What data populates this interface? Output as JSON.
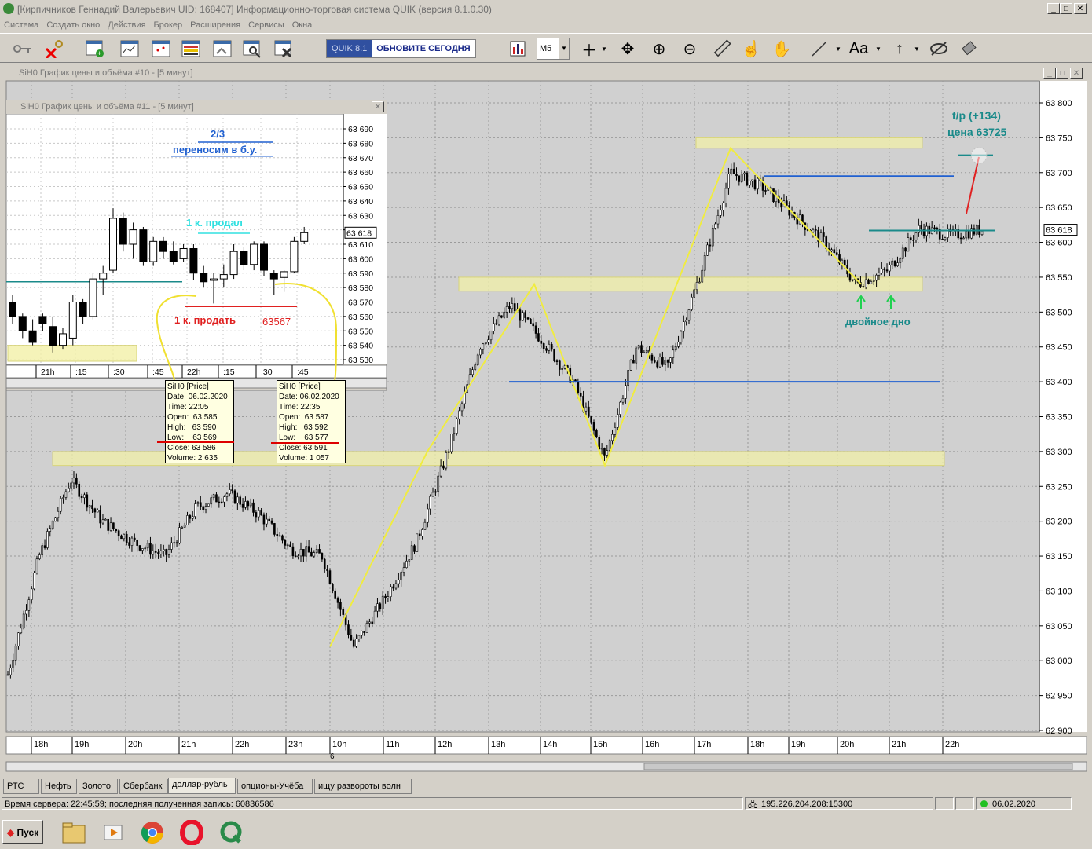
{
  "window": {
    "title": "[Кирпичников Геннадий Валерьевич UID: 168407] Информационно-торговая система QUIK (версия 8.1.0.30)"
  },
  "menu": [
    "Система",
    "Создать окно",
    "Действия",
    "Брокер",
    "Расширения",
    "Сервисы",
    "Окна"
  ],
  "toolbar": {
    "quik_label": "QUIK 8.1",
    "update_label": "ОБНОВИТЕ СЕГОДНЯ",
    "timeframe": "M5",
    "font_label": "Aa"
  },
  "icons": [
    "keys-icon",
    "keys-delete-icon",
    "new-window-icon",
    "chart-window-icon",
    "chart2-icon",
    "table-icon",
    "order-icon",
    "search-icon",
    "delete-icon",
    "indicator-icon",
    "crosshair-icon",
    "move-icon",
    "zoom-in-icon",
    "zoom-out-icon",
    "ruler-icon",
    "hand-pointer-icon",
    "hand-icon",
    "line-icon",
    "arrow-up-icon",
    "eye-off-icon",
    "eraser-icon"
  ],
  "main_chart": {
    "title": "SiH0 График цены и объёма #10 - [5 минут]",
    "y_ticks": [
      "63 800",
      "63 750",
      "63 700",
      "63 650",
      "63 600",
      "63 550",
      "63 500",
      "63 450",
      "63 400",
      "63 350",
      "63 300",
      "63 250",
      "63 200",
      "63 150",
      "63 100",
      "63 050",
      "63 000",
      "62 950",
      "62 900"
    ],
    "x_ticks": [
      "18h",
      "19h",
      "20h",
      "21h",
      "22h",
      "23h",
      "10h",
      "11h",
      "12h",
      "13h",
      "14h",
      "15h",
      "16h",
      "17h",
      "18h",
      "19h",
      "20h",
      "21h",
      "22h"
    ],
    "day_label": "6",
    "last_price": "63 618",
    "annotations": {
      "tp": "t/p (+134)",
      "price": "цена  63725",
      "double_bottom": "двойное дно"
    }
  },
  "inset_chart": {
    "title": "SiH0 График цены и объёма #11 - [5 минут]",
    "y_ticks": [
      "63 690",
      "63 680",
      "63 670",
      "63 660",
      "63 650",
      "63 640",
      "63 630",
      "63 620",
      "63 610",
      "63 600",
      "63 590",
      "63 580",
      "63 570",
      "63 560",
      "63 550",
      "63 540",
      "63 530"
    ],
    "x_ticks": [
      "21h",
      ":15",
      ":30",
      ":45",
      "22h",
      ":15",
      ":30",
      ":45"
    ],
    "last_price": "63 618",
    "annotations": {
      "fraction": "2/3",
      "move_be": "переносим в б.у.",
      "sold": "1 к. продал",
      "sell": "1 к. продать",
      "sell_price": "63567"
    }
  },
  "tooltips": [
    {
      "title": "SiH0 [Price]",
      "date": "Date: 06.02.2020",
      "time": "Time: 22:05",
      "open": "Open:  63 585",
      "high": "High:   63 590",
      "low": "Low:    63 569",
      "close": "Close: 63 586",
      "volume": "Volume: 2 635"
    },
    {
      "title": "SiH0 [Price]",
      "date": "Date: 06.02.2020",
      "time": "Time: 22:35",
      "open": "Open:  63 587",
      "high": "High:   63 592",
      "low": "Low:    63 577",
      "close": "Close: 63 591",
      "volume": "Volume: 1 057"
    }
  ],
  "tabs": [
    "РТС",
    "Нефть",
    "Золото",
    "Сбербанк",
    "доллар-рубль",
    "опционы-Учёба",
    "ищу развороты волн"
  ],
  "active_tab": "доллар-рубль",
  "status": {
    "server_time": "Время сервера: 22:45:59; последняя полученная запись: 60836586",
    "ip": "195.226.204.208:15300",
    "date": "06.02.2020"
  },
  "taskbar": {
    "start_label": "Пуск"
  },
  "chart_data": [
    {
      "type": "candlestick",
      "title": "SiH0 График цены и объёма #10 - [5 минут]",
      "ylim": [
        62900,
        63800
      ],
      "x": [
        "18h",
        "19h",
        "20h",
        "21h",
        "22h",
        "23h",
        "10h",
        "11h",
        "12h",
        "13h",
        "14h",
        "15h",
        "16h",
        "17h",
        "18h",
        "19h",
        "20h",
        "21h",
        "22h"
      ],
      "close_path": [
        62980,
        63150,
        63260,
        63200,
        63170,
        63150,
        63220,
        63240,
        63210,
        63160,
        63150,
        63020,
        63090,
        63170,
        63300,
        63450,
        63510,
        63460,
        63400,
        63290,
        63450,
        63420,
        63550,
        63700,
        63680,
        63640,
        63600,
        63540,
        63560,
        63620,
        63610,
        63618
      ],
      "levels": [
        63725,
        63695,
        63617,
        63540,
        63400,
        63290
      ],
      "zones": [
        [
          63735,
          63750
        ],
        [
          63530,
          63550
        ],
        [
          63280,
          63300
        ]
      ]
    },
    {
      "type": "candlestick",
      "title": "SiH0 График цены и объёма #11 - [5 минут]",
      "ylim": [
        63530,
        63690
      ],
      "x": [
        "21h",
        ":15",
        ":30",
        ":45",
        "22h",
        ":15",
        ":30",
        ":45"
      ],
      "candles": [
        [
          63570,
          63575,
          63555,
          63560
        ],
        [
          63560,
          63562,
          63545,
          63550
        ],
        [
          63550,
          63558,
          63540,
          63542
        ],
        [
          63560,
          63562,
          63550,
          63555
        ],
        [
          63553,
          63560,
          63535,
          63540
        ],
        [
          63540,
          63552,
          63537,
          63548
        ],
        [
          63545,
          63575,
          63540,
          63570
        ],
        [
          63570,
          63572,
          63555,
          63560
        ],
        [
          63560,
          63590,
          63558,
          63586
        ],
        [
          63586,
          63595,
          63575,
          63590
        ],
        [
          63592,
          63635,
          63590,
          63628
        ],
        [
          63628,
          63632,
          63605,
          63610
        ],
        [
          63610,
          63625,
          63600,
          63620
        ],
        [
          63620,
          63622,
          63595,
          63598
        ],
        [
          63598,
          63615,
          63595,
          63612
        ],
        [
          63612,
          63615,
          63600,
          63605
        ],
        [
          63605,
          63612,
          63596,
          63598
        ],
        [
          63600,
          63610,
          63598,
          63607
        ],
        [
          63607,
          63610,
          63585,
          63590
        ],
        [
          63590,
          63595,
          63580,
          63584
        ],
        [
          63585,
          63590,
          63569,
          63586
        ],
        [
          63586,
          63596,
          63580,
          63589
        ],
        [
          63589,
          63610,
          63586,
          63605
        ],
        [
          63605,
          63608,
          63592,
          63596
        ],
        [
          63596,
          63612,
          63592,
          63610
        ],
        [
          63610,
          63612,
          63588,
          63592
        ],
        [
          63590,
          63592,
          63575,
          63586
        ],
        [
          63587,
          63592,
          63577,
          63591
        ],
        [
          63591,
          63615,
          63590,
          63612
        ],
        [
          63612,
          63622,
          63610,
          63618
        ]
      ],
      "levels": [
        63584,
        63567
      ]
    }
  ]
}
